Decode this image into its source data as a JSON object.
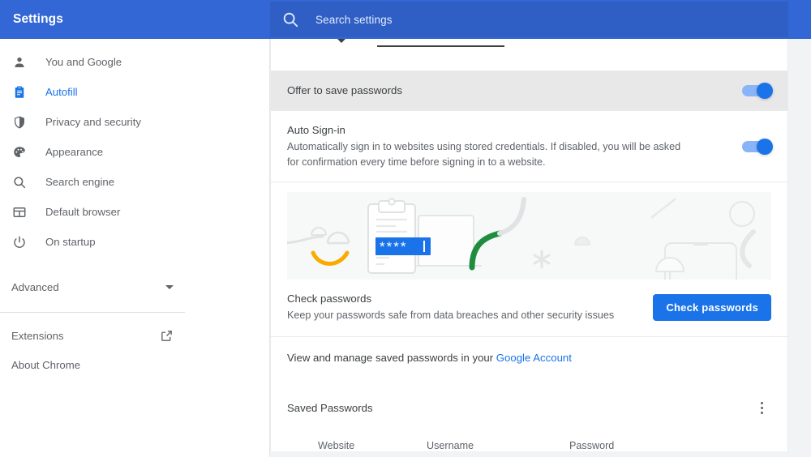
{
  "header": {
    "title": "Settings",
    "search_placeholder": "Search settings",
    "search_value": "",
    "search_icon": "search-icon",
    "bg_color": "#3367d6",
    "search_bg_color": "#2f5fc4"
  },
  "sidebar": {
    "items": [
      {
        "label": "You and Google",
        "icon": "person-icon",
        "active": false
      },
      {
        "label": "Autofill",
        "icon": "clipboard-icon",
        "active": true
      },
      {
        "label": "Privacy and security",
        "icon": "shield-icon",
        "active": false
      },
      {
        "label": "Appearance",
        "icon": "palette-icon",
        "active": false
      },
      {
        "label": "Search engine",
        "icon": "search-icon",
        "active": false
      },
      {
        "label": "Default browser",
        "icon": "browser-window-icon",
        "active": false
      },
      {
        "label": "On startup",
        "icon": "power-icon",
        "active": false
      }
    ],
    "advanced": {
      "label": "Advanced",
      "icon": "chevron-down-icon"
    },
    "extensions": {
      "label": "Extensions",
      "icon": "open-in-new-icon"
    },
    "about": {
      "label": "About Chrome"
    },
    "active_color": "#1a73e8",
    "text_color": "#5f6368"
  },
  "main": {
    "offer_to_save": {
      "title": "Offer to save passwords",
      "toggle_on": true,
      "highlighted": true
    },
    "auto_signin": {
      "title": "Auto Sign-in",
      "description": "Automatically sign in to websites using stored credentials. If disabled, you will be asked for confirmation every time before signing in to a website.",
      "toggle_on": true
    },
    "illustration": {
      "name": "password-check-illustration",
      "password_field_text": "****",
      "accent_blue": "#1a73e8",
      "accent_green": "#1e8e3e",
      "accent_yellow": "#f9ab00"
    },
    "check_passwords": {
      "title": "Check passwords",
      "description": "Keep your passwords safe from data breaches and other security issues",
      "button_label": "Check passwords",
      "button_color": "#1a73e8"
    },
    "manage_link": {
      "prefix": "View and manage saved passwords in your ",
      "link_text": "Google Account"
    },
    "saved_passwords": {
      "title": "Saved Passwords",
      "menu_icon": "more-vert-icon",
      "columns": [
        "Website",
        "Username",
        "Password"
      ],
      "rows": []
    }
  }
}
